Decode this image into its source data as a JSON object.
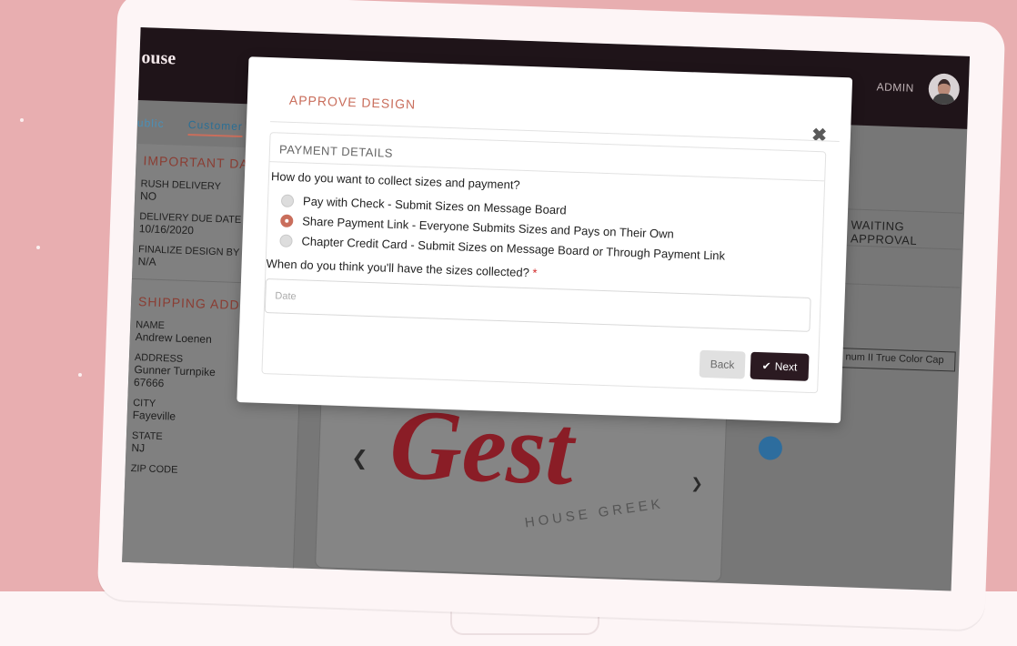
{
  "app": {
    "brand": "ouse",
    "admin_label": "ADMIN",
    "tabs": [
      "ublic",
      "Customer"
    ]
  },
  "left_panel": {
    "important_title": "IMPORTANT DATE",
    "important_fields": [
      {
        "label": "RUSH DELIVERY",
        "value": "NO"
      },
      {
        "label": "DELIVERY DUE DATE",
        "value": "10/16/2020"
      },
      {
        "label": "FINALIZE DESIGN BY",
        "value": "N/A"
      }
    ],
    "shipping_title": "SHIPPING ADDRE",
    "shipping_fields": [
      {
        "label": "NAME",
        "value": "Andrew Loenen"
      },
      {
        "label": "ADDRESS",
        "value": "Gunner Turnpike"
      },
      {
        "label": "",
        "value": "67666"
      },
      {
        "label": "CITY",
        "value": "Fayeville"
      },
      {
        "label": "STATE",
        "value": "NJ"
      },
      {
        "label": "ZIP CODE",
        "value": ""
      }
    ]
  },
  "right_panel": {
    "status": "WAITING APPROVAL",
    "product": "num II True Color Cap"
  },
  "design": {
    "script_text": "Gest",
    "circular_text": "HOUSE GREEK"
  },
  "modal": {
    "title": "APPROVE DESIGN",
    "close_icon": "close-icon",
    "section_title": "PAYMENT DETAILS",
    "question_collect": "How do you want to collect sizes and payment?",
    "options": [
      {
        "label": "Pay with Check - Submit Sizes on Message Board",
        "selected": false
      },
      {
        "label": "Share Payment Link - Everyone Submits Sizes and Pays on Their Own",
        "selected": true
      },
      {
        "label": "Chapter Credit Card - Submit Sizes on Message Board or Through Payment Link",
        "selected": false
      }
    ],
    "question_date": "When do you think you'll have the sizes collected?",
    "required_mark": "*",
    "date_placeholder": "Date",
    "back_label": "Back",
    "next_label": "Next"
  },
  "colors": {
    "background": "#e8aeb0",
    "accent": "#c96e5c",
    "header_dark": "#1f1419",
    "next_button": "#2b1a21"
  }
}
